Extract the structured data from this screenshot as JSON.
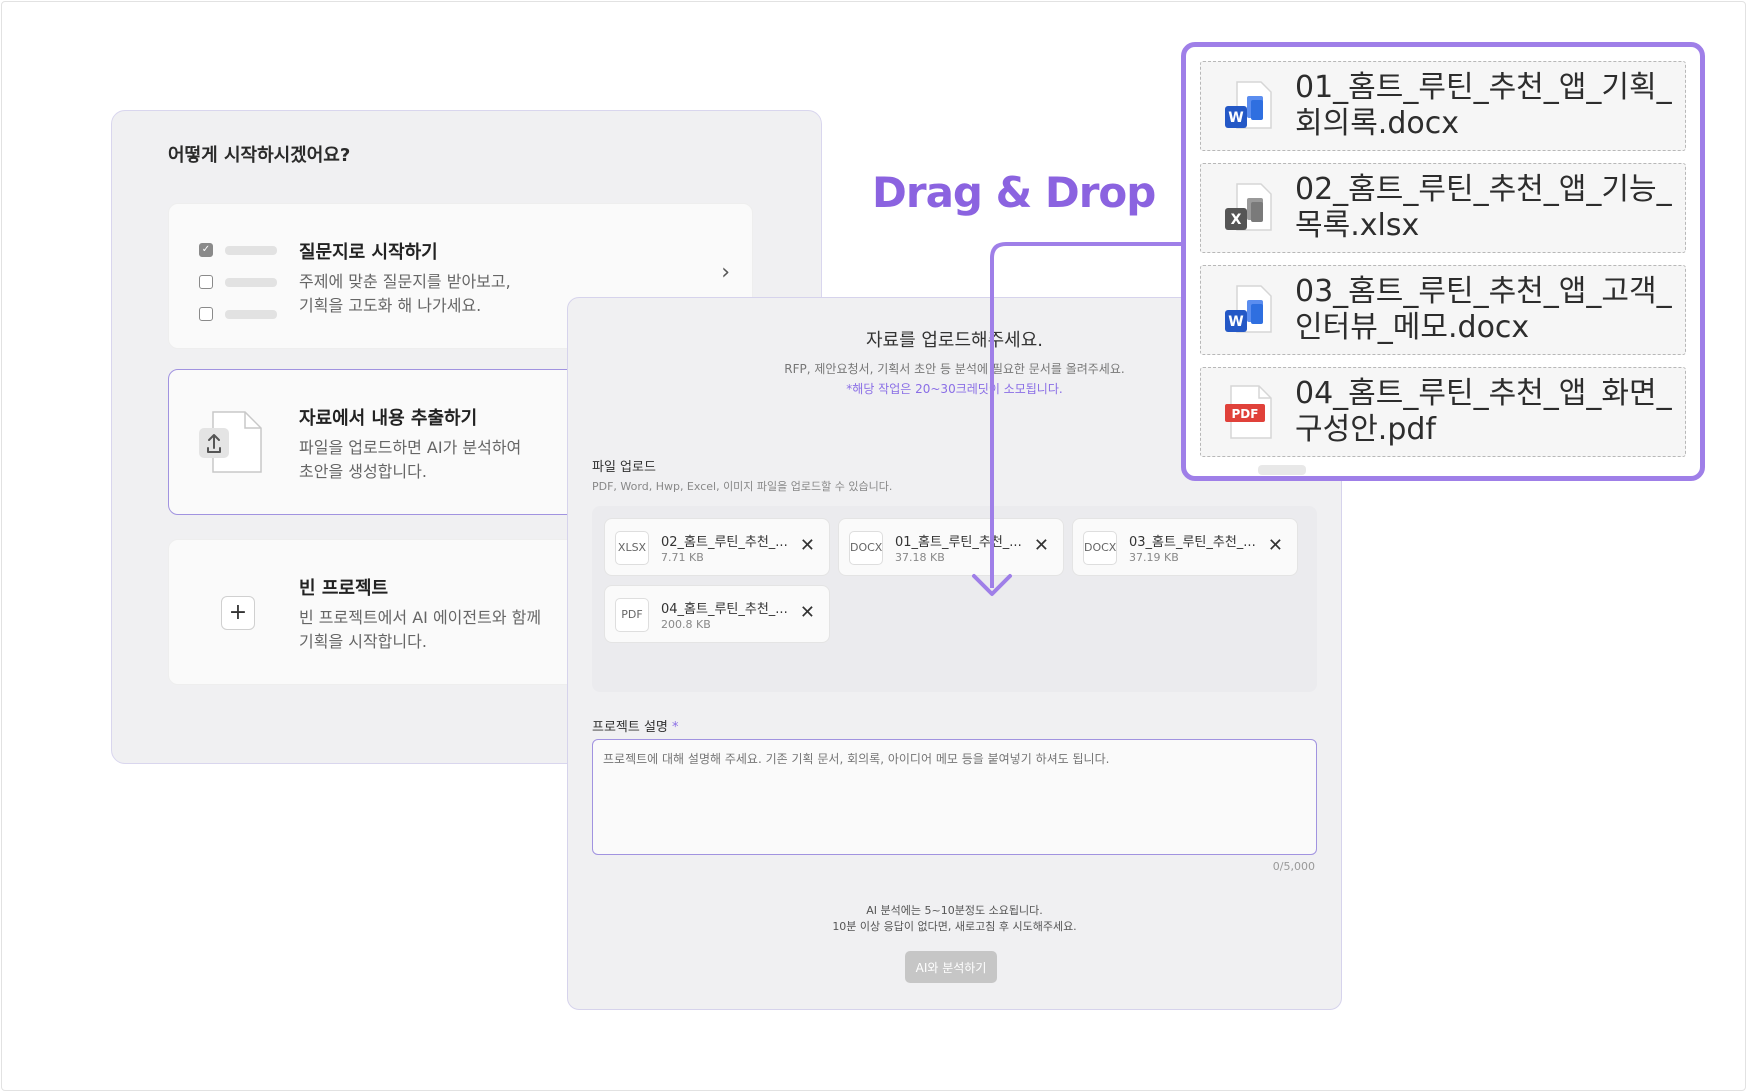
{
  "start": {
    "title": "어떻게 시작하시겠어요?",
    "options": [
      {
        "title": "질문지로 시작하기",
        "desc": "주제에 맞춘 질문지를 받아보고,\n기획을 고도화 해 나가세요."
      },
      {
        "title": "자료에서 내용 추출하기",
        "desc": "파일을 업로드하면 AI가 분석하여\n초안을 생성합니다."
      },
      {
        "title": "빈 프로젝트",
        "desc": "빈 프로젝트에서 AI 에이전트와 함께\n기획을 시작합니다."
      }
    ]
  },
  "upload": {
    "title": "자료를 업로드해주세요.",
    "subtitle": "RFP, 제안요청서, 기획서 초안 등 분석에 필요한 문서를 올려주세요.",
    "note": "*해당 작업은 20~30크레딧이 소모됩니다.",
    "section_label": "파일 업로드",
    "section_hint": "PDF, Word, Hwp, Excel, 이미지 파일을 업로드할 수 있습니다.",
    "files": [
      {
        "type": "XLSX",
        "name": "02_홈트_루틴_추천_...",
        "size": "7.71 KB"
      },
      {
        "type": "DOCX",
        "name": "01_홈트_루틴_추천_...",
        "size": "37.18 KB"
      },
      {
        "type": "DOCX",
        "name": "03_홈트_루틴_추천_...",
        "size": "37.19 KB"
      },
      {
        "type": "PDF",
        "name": "04_홈트_루틴_추천_...",
        "size": "200.8 KB"
      }
    ],
    "desc_label": "프로젝트 설명",
    "required_mark": "*",
    "desc_placeholder": "프로젝트에 대해 설명해 주세요. 기존 기획 문서, 회의록, 아이디어 메모 등을 붙여넣기 하셔도 됩니다.",
    "counter": "0/5,000",
    "info_line1": "AI 분석에는 5~10분정도 소요됩니다.",
    "info_line2": "10분 이상 응답이 없다면, 새로고침 후 시도해주세요.",
    "analyze_label": "AI와 분석하기"
  },
  "drag_label": "Drag & Drop",
  "dragged_files": [
    {
      "icon": "word-icon",
      "name": "01_홈트_루틴_추천_앱_기획_회의록.docx"
    },
    {
      "icon": "excel-icon",
      "name": "02_홈트_루틴_추천_앱_기능_목록.xlsx"
    },
    {
      "icon": "word-icon",
      "name": "03_홈트_루틴_추천_앱_고객_인터뷰_메모.docx"
    },
    {
      "icon": "pdf-icon",
      "name": "04_홈트_루틴_추천_앱_화면_구성안.pdf"
    }
  ],
  "colors": {
    "accent": "#8b63e0",
    "panel_border": "#9f7fe8",
    "focus_border": "#a193e0"
  }
}
